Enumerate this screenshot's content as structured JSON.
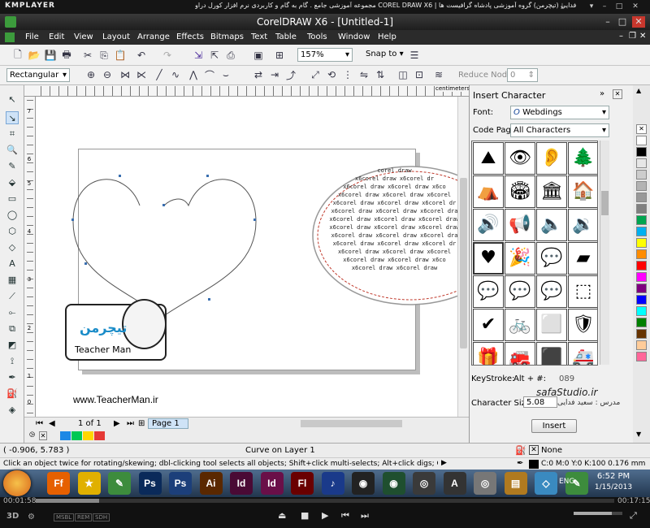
{
  "player": {
    "logo": "KMPLAYER",
    "title": "مجموعه آموزشی جامع . گام به گام و کاربردی نرم افزار کورل دراو COREL DRAW X6 | مدرس : سعید فدایی (تیچرمن) گروه آموزشی پادشاه گرافیست ها",
    "elapsed": "00:01:58",
    "total": "00:17:15",
    "quality_tags": [
      "MSBL",
      "REM",
      "SDH"
    ]
  },
  "window": {
    "title": "CorelDRAW X6 - [Untitled-1]"
  },
  "menu": [
    "File",
    "Edit",
    "View",
    "Layout",
    "Arrange",
    "Effects",
    "Bitmaps",
    "Text",
    "Table",
    "Tools",
    "Window",
    "Help"
  ],
  "standard_bar": {
    "zoom": "157%",
    "snap_to": "Snap to"
  },
  "property_bar": {
    "selection_mode": "Rectangular",
    "reduce_nodes_label": "Reduce Nodes",
    "reduce_nodes_value": "0"
  },
  "ruler": {
    "unit": "centimeters",
    "h_ticks": [
      "0",
      "1",
      "2",
      "3",
      "4",
      "5",
      "6",
      "7",
      "8",
      "9"
    ],
    "v_ticks": [
      "7",
      "6",
      "5",
      "4",
      "3",
      "2",
      "1",
      "0"
    ],
    "v_unit": "centimeters"
  },
  "page_nav": {
    "page_of": "1 of 1",
    "tab": "Page 1"
  },
  "canvas": {
    "ellipse_text_head": "corel draw",
    "ellipse_text": [
      "x6corel draw x6corel dr",
      "x6corel draw x6corel draw x6co",
      "x6corel draw x6corel draw x6corel",
      "x6corel draw x6corel draw x6corel dr",
      "x6corel draw x6corel draw x6corel dra",
      "x6corel draw x6corel draw x6corel draw",
      "x6corel draw x6corel draw x6corel draw",
      "x6corel draw x6corel draw x6corel dra",
      "x6corel draw x6corel draw x6corel dr",
      "x6corel draw x6corel draw x6corel",
      "x6corel draw x6corel draw x6co",
      "x6corel draw x6corel draw"
    ],
    "website": "www.TeacherMan.ir",
    "logo_fa": "تیچرمن",
    "logo_en": "Teacher Man"
  },
  "docker": {
    "title": "Insert Character",
    "font_label": "Font:",
    "font_value": "Webdings",
    "codepage_label": "Code Page:",
    "codepage_value": "All Characters",
    "keystroke_label": "KeyStroke:",
    "keystroke_value": "Alt + #:",
    "keystroke_code": "089",
    "charsize_label": "Character Size:",
    "charsize_value": "5.08",
    "insert_button": "Insert",
    "watermark_site": "safaStudio.ir",
    "watermark_teacher": "مدرس : سعید فدایی"
  },
  "glyphs": [
    "⛰",
    "👁",
    "👂",
    "🌲",
    "⛺",
    "🏟",
    "🏛",
    "🏠",
    "🔊",
    "📢",
    "🔈",
    "🔉",
    "♥",
    "🎉",
    "💬",
    "▰",
    "💬",
    "💬",
    "💬",
    "⬚",
    "✔",
    "🚲",
    "⬜",
    "🛡",
    "🎁",
    "🚒",
    "⬛",
    "🚑"
  ],
  "palette_colors": [
    "#ffffff",
    "#000000",
    "#e6e6e6",
    "#cccccc",
    "#b3b3b3",
    "#999999",
    "#808080",
    "#00a550",
    "#00b0f0",
    "#ffff00",
    "#ff8c00",
    "#ff0000",
    "#ff00ff",
    "#7f007f",
    "#0000ff",
    "#00ffff",
    "#008000",
    "#663300",
    "#ffcc99",
    "#ff6699"
  ],
  "doc_palette": [
    "#1e88e5",
    "#00c853",
    "#ffd600",
    "#e53935"
  ],
  "status": {
    "coords": "( -0.906, 5.783 )",
    "object": "Curve on Layer 1",
    "fill_label": "None",
    "outline": "C:0 M:0 Y:0 K:100  0.176 mm",
    "hint": "Click an object twice for rotating/skewing; dbl-clicking tool selects all objects; Shift+click multi-selects; Alt+click digs; Ctrl+click selects in a group"
  },
  "taskbar": {
    "lang": "ENG",
    "time": "6:52 PM",
    "date": "1/15/2013",
    "apps": [
      {
        "label": "Ff",
        "color": "#e66000"
      },
      {
        "label": "★",
        "color": "#e0b000"
      },
      {
        "label": "✎",
        "color": "#3d8c3d"
      },
      {
        "label": "Ps",
        "color": "#0a2a5a"
      },
      {
        "label": "Ps",
        "color": "#1c3f7a"
      },
      {
        "label": "Ai",
        "color": "#5a2800"
      },
      {
        "label": "Id",
        "color": "#4a0a35"
      },
      {
        "label": "Id",
        "color": "#6a0f48"
      },
      {
        "label": "Fl",
        "color": "#6a0000"
      },
      {
        "label": "♪",
        "color": "#1a3a8a"
      },
      {
        "label": "◉",
        "color": "#222222"
      },
      {
        "label": "◉",
        "color": "#1f4f2f"
      },
      {
        "label": "◎",
        "color": "#3a3a3a"
      },
      {
        "label": "A",
        "color": "#333333"
      },
      {
        "label": "◎",
        "color": "#777777"
      },
      {
        "label": "▤",
        "color": "#b07a20"
      },
      {
        "label": "◇",
        "color": "#3a8ac0"
      },
      {
        "label": "✎",
        "color": "#3d8c3d"
      }
    ]
  }
}
